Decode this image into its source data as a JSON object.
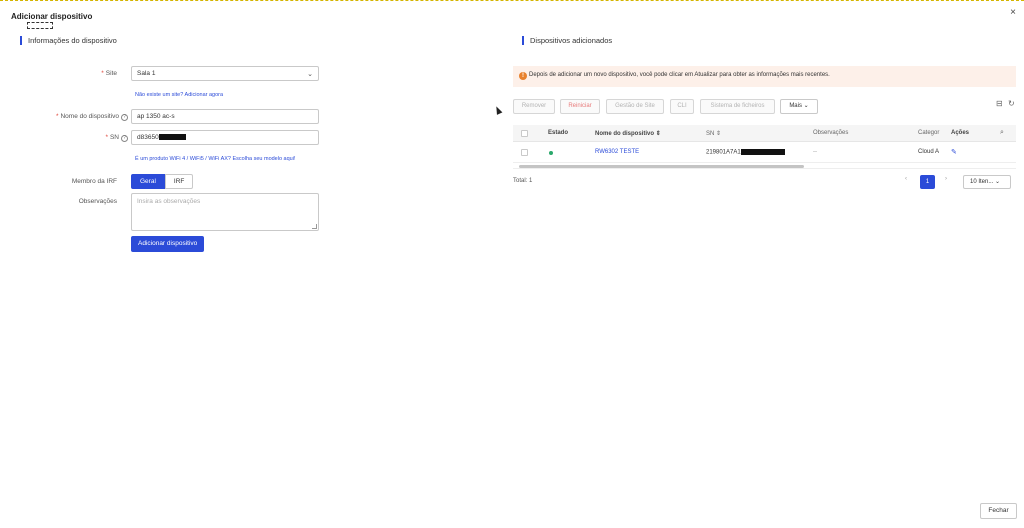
{
  "dialog": {
    "title": "Adicionar dispositivo",
    "close_icon": "close-icon",
    "close_glyph": "×"
  },
  "left": {
    "section_title": "Informações do dispositivo",
    "site_label": "Site",
    "site_value": "Sala 1",
    "site_link": "Não existe um site? Adicionar agora",
    "name_label": "Nome do dispositivo",
    "name_value": "ap 1350 ac-s",
    "sn_label": "SN",
    "sn_value": "d83650",
    "sn_link": "É um produto WiFi 4 / WiFi5 / WiFi AX? Escolha seu modelo aqui!",
    "irf_label": "Membro da IRF",
    "irf_options": [
      "Geral",
      "IRF"
    ],
    "notes_label": "Observações",
    "notes_placeholder": "Insira as observações",
    "submit_label": "Adicionar dispositivo",
    "required_mark": "*",
    "help_glyph": "?",
    "chevron_glyph": "⌄"
  },
  "right": {
    "section_title": "Dispositivos adicionados",
    "alert": "Depois de adicionar um novo dispositivo, você pode clicar em Atualizar para obter as informações mais recentes.",
    "alert_glyph": "!",
    "toolbar": [
      "Remover",
      "Reiniciar",
      "Gestão de Site",
      "CLI",
      "Sistema de ficheiros",
      "Mais"
    ],
    "toolbar_icons": {
      "export": "⊟",
      "refresh": "↻"
    },
    "table": {
      "headers": [
        "Estado",
        "Nome do dispositivo",
        "SN",
        "Observações",
        "Categor",
        "Ações"
      ],
      "sort_glyph": "⇕",
      "search_glyph": "⌕",
      "rows": [
        {
          "status": "online",
          "name": "RW6302 TESTE",
          "sn": "219801A7A1",
          "notes": "--",
          "category": "Cloud A",
          "action_glyph": "✎"
        }
      ]
    },
    "total": "Total: 1",
    "page": "1",
    "page_size": "10 Iten...",
    "page_prev_glyph": "‹",
    "page_next_glyph": "›"
  },
  "footer": {
    "close_label": "Fechar"
  },
  "colors": {
    "primary": "#2b4bd8",
    "danger": "#e0463a",
    "warning": "#e8812c",
    "online": "#2aa86b"
  }
}
